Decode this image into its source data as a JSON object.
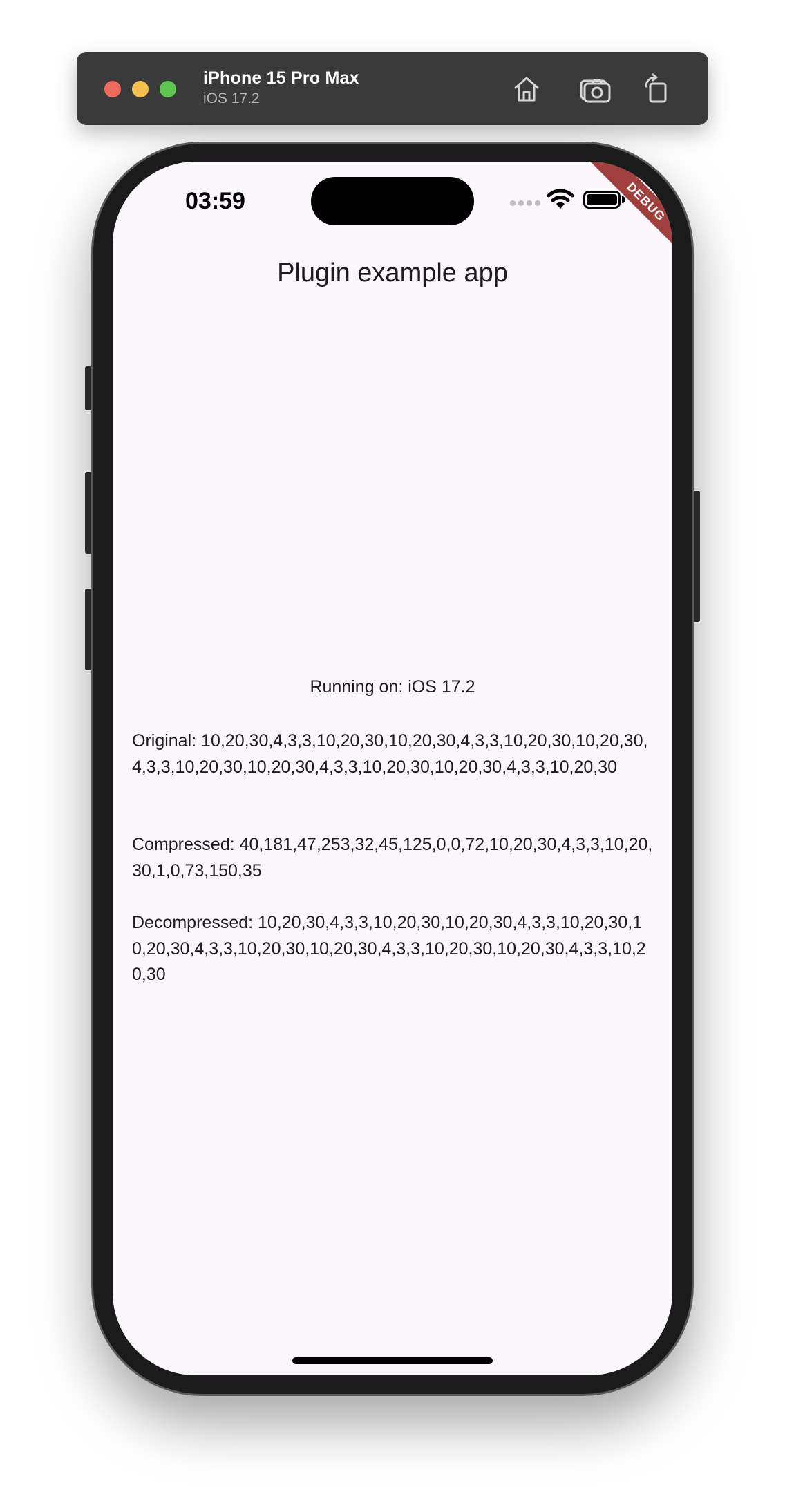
{
  "simulator": {
    "device_name": "iPhone 15 Pro Max",
    "os_version": "iOS 17.2"
  },
  "status_bar": {
    "time": "03:59"
  },
  "debug_banner": "DEBUG",
  "app": {
    "title": "Plugin example app",
    "running_on": "Running on: iOS 17.2",
    "original": "Original: 10,20,30,4,3,3,10,20,30,10,20,30,4,3,3,10,20,30,10,20,30,4,3,3,10,20,30,10,20,30,4,3,3,10,20,30,10,20,30,4,3,3,10,20,30",
    "compressed": "Compressed: 40,181,47,253,32,45,125,0,0,72,10,20,30,4,3,3,10,20,30,1,0,73,150,35",
    "decompressed": "Decompressed: 10,20,30,4,3,3,10,20,30,10,20,30,4,3,3,10,20,30,10,20,30,4,3,3,10,20,30,10,20,30,4,3,3,10,20,30,10,20,30,4,3,3,10,20,30"
  }
}
